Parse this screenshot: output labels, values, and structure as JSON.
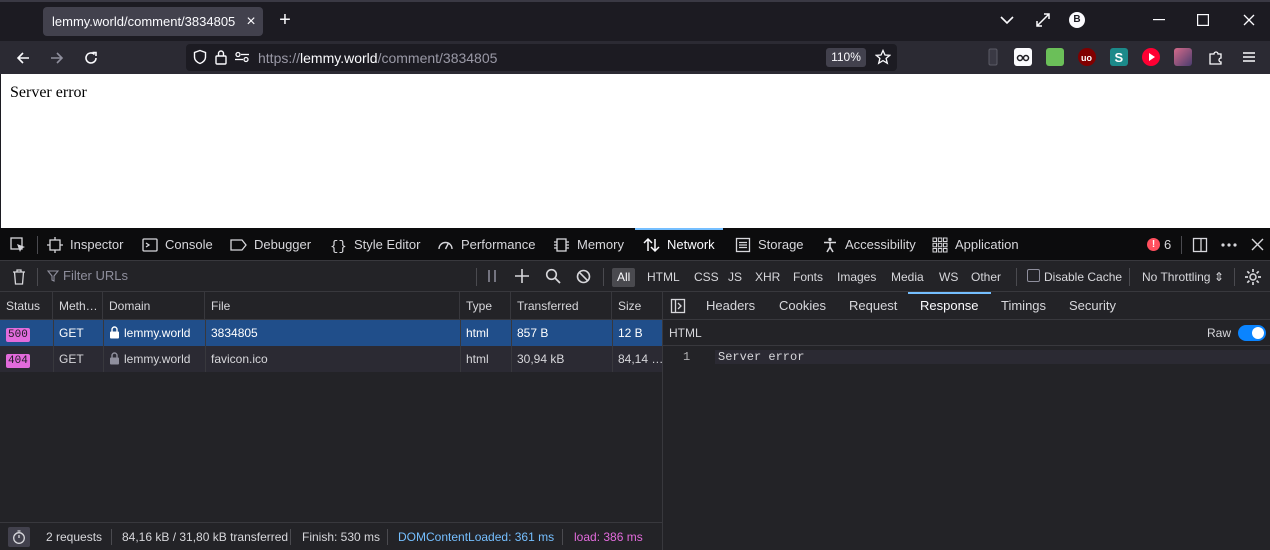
{
  "tab": {
    "title": "lemmy.world/comment/3834805",
    "close": "×",
    "new": "+"
  },
  "profile": {
    "initial": "B"
  },
  "url": {
    "scheme": "https://",
    "host": "lemmy.world",
    "path": "/comment/3834805",
    "zoom": "110%"
  },
  "page": {
    "body_text": "Server error"
  },
  "devtools": {
    "tabs": [
      "Inspector",
      "Console",
      "Debugger",
      "Style Editor",
      "Performance",
      "Memory",
      "Network",
      "Storage",
      "Accessibility",
      "Application"
    ],
    "active_tab": "Network",
    "error_count": "6"
  },
  "toolbar": {
    "filter_placeholder": "Filter URLs",
    "types": [
      "All",
      "HTML",
      "CSS",
      "JS",
      "XHR",
      "Fonts",
      "Images",
      "Media",
      "WS",
      "Other"
    ],
    "active_type": "All",
    "disable_cache": "Disable Cache",
    "throttling": "No Throttling ⇕"
  },
  "table": {
    "columns": [
      "Status",
      "Meth…",
      "Domain",
      "File",
      "Type",
      "Transferred",
      "Size"
    ],
    "rows": [
      {
        "status": "500",
        "method": "GET",
        "domain": "lemmy.world",
        "file": "3834805",
        "type": "html",
        "transferred": "857 B",
        "size": "12 B"
      },
      {
        "status": "404",
        "method": "GET",
        "domain": "lemmy.world",
        "file": "favicon.ico",
        "type": "html",
        "transferred": "30,94 kB",
        "size": "84,14 …"
      }
    ]
  },
  "details": {
    "tabs": [
      "Headers",
      "Cookies",
      "Request",
      "Response",
      "Timings",
      "Security"
    ],
    "active_tab": "Response",
    "format": "HTML",
    "raw_label": "Raw",
    "raw_enabled": true,
    "lines": [
      {
        "n": "1",
        "text": "Server error"
      }
    ]
  },
  "status": {
    "requests": "2 requests",
    "transferred": "84,16 kB / 31,80 kB transferred",
    "finish": "Finish: 530 ms",
    "dom_loaded": "DOMContentLoaded: 361 ms",
    "load": "load: 386 ms"
  },
  "colors": {
    "dom_loaded": "#75bfff",
    "load": "#e26bdc",
    "selected_row": "#204e8a",
    "active_tab_line": "#75bfff"
  }
}
